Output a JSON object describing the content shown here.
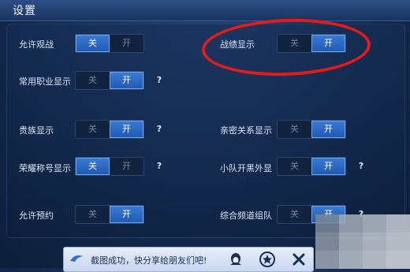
{
  "window": {
    "title": "设置"
  },
  "settings": [
    {
      "label": "允许观战",
      "off": "关",
      "on": "开",
      "state": "off",
      "help": false
    },
    {
      "label": "战绩显示",
      "off": "关",
      "on": "开",
      "state": "on",
      "help": false
    },
    {
      "label": "常用职业显示",
      "off": "关",
      "on": "开",
      "state": "on",
      "help": true
    },
    {
      "label": "贵族显示",
      "off": "关",
      "on": "开",
      "state": "on",
      "help": true
    },
    {
      "label": "亲密关系显示",
      "off": "关",
      "on": "开",
      "state": "on",
      "help": false
    },
    {
      "label": "荣耀称号显示",
      "off": "关",
      "on": "开",
      "state": "off",
      "help": true
    },
    {
      "label": "小队开黑外显",
      "off": "关",
      "on": "开",
      "state": "on",
      "help": true
    },
    {
      "label": "允许预约",
      "off": "关",
      "on": "开",
      "state": "on",
      "help": false
    },
    {
      "label": "综合频道组队",
      "off": "关",
      "on": "开",
      "state": "on",
      "help": true
    }
  ],
  "help_glyph": "?",
  "toast": {
    "text": "截图成功，快分享给朋友们吧!"
  },
  "colors": {
    "accent": "#2f6fcb",
    "annotation": "#e21b1b"
  },
  "icons": [
    "qq-icon",
    "qzone-star-icon",
    "close-icon"
  ]
}
